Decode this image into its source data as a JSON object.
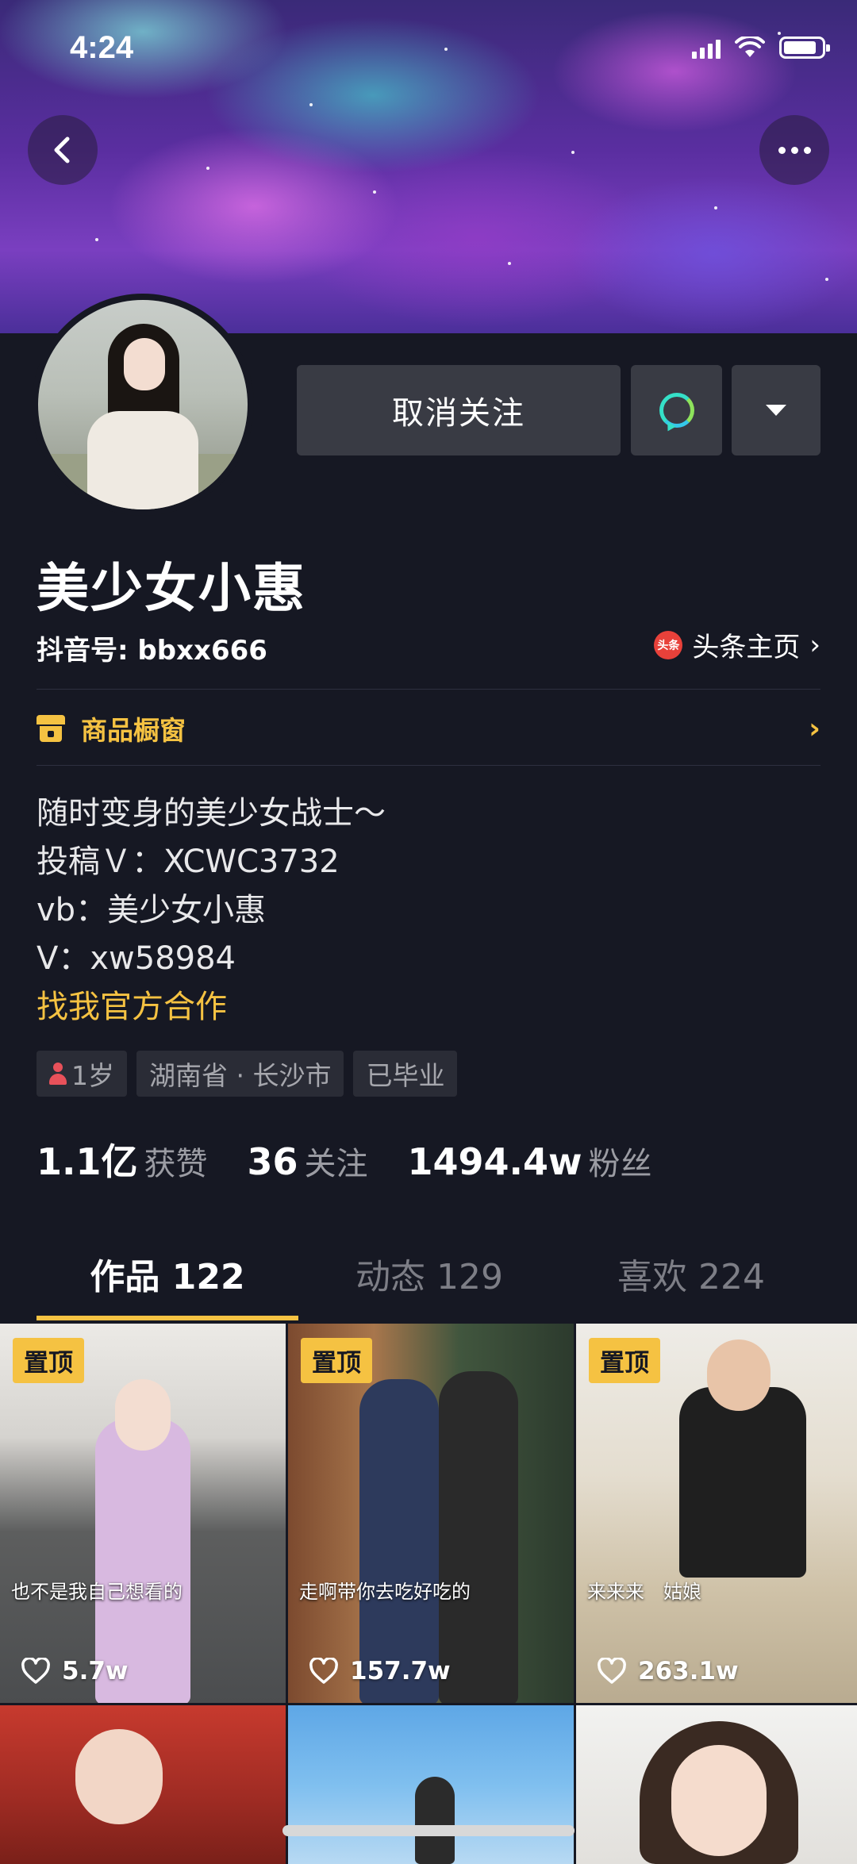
{
  "status_bar": {
    "time": "4:24"
  },
  "header": {
    "back_icon": "chevron-left-icon",
    "more_icon": "more-dots-icon"
  },
  "actions": {
    "unfollow_label": "取消关注",
    "message_icon": "message-bubble-icon",
    "dropdown_icon": "triangle-down-icon"
  },
  "profile": {
    "name": "美少女小惠",
    "douyin_id": "抖音号: bbxx666",
    "toutiao_logo": "头条",
    "toutiao_label": "头条主页",
    "shop_label": "商品橱窗",
    "bio": [
      "随时变身的美少女战士～",
      "投稿Ｖ：XCWC3732",
      "vb：美少女小惠",
      "V：xw58984"
    ],
    "bio_link": "找我官方合作",
    "tags": {
      "age": "1岁",
      "location": "湖南省 · 长沙市",
      "status": "已毕业"
    },
    "stats": [
      {
        "value": "1.1亿",
        "label": "获赞"
      },
      {
        "value": "36",
        "label": "关注"
      },
      {
        "value": "1494.4w",
        "label": "粉丝"
      }
    ]
  },
  "tabs": [
    {
      "label": "作品 122",
      "active": true
    },
    {
      "label": "动态 129",
      "active": false
    },
    {
      "label": "喜欢 224",
      "active": false
    }
  ],
  "videos": [
    {
      "pinned": "置顶",
      "caption": "也不是我自己想看的",
      "likes": "5.7w"
    },
    {
      "pinned": "置顶",
      "caption": "走啊带你去吃好吃的",
      "likes": "157.7w"
    },
    {
      "pinned": "置顶",
      "caption": "来来来　姑娘",
      "likes": "263.1w"
    }
  ],
  "colors": {
    "background": "#161823",
    "accent": "#f5c242",
    "button": "#393b44"
  }
}
